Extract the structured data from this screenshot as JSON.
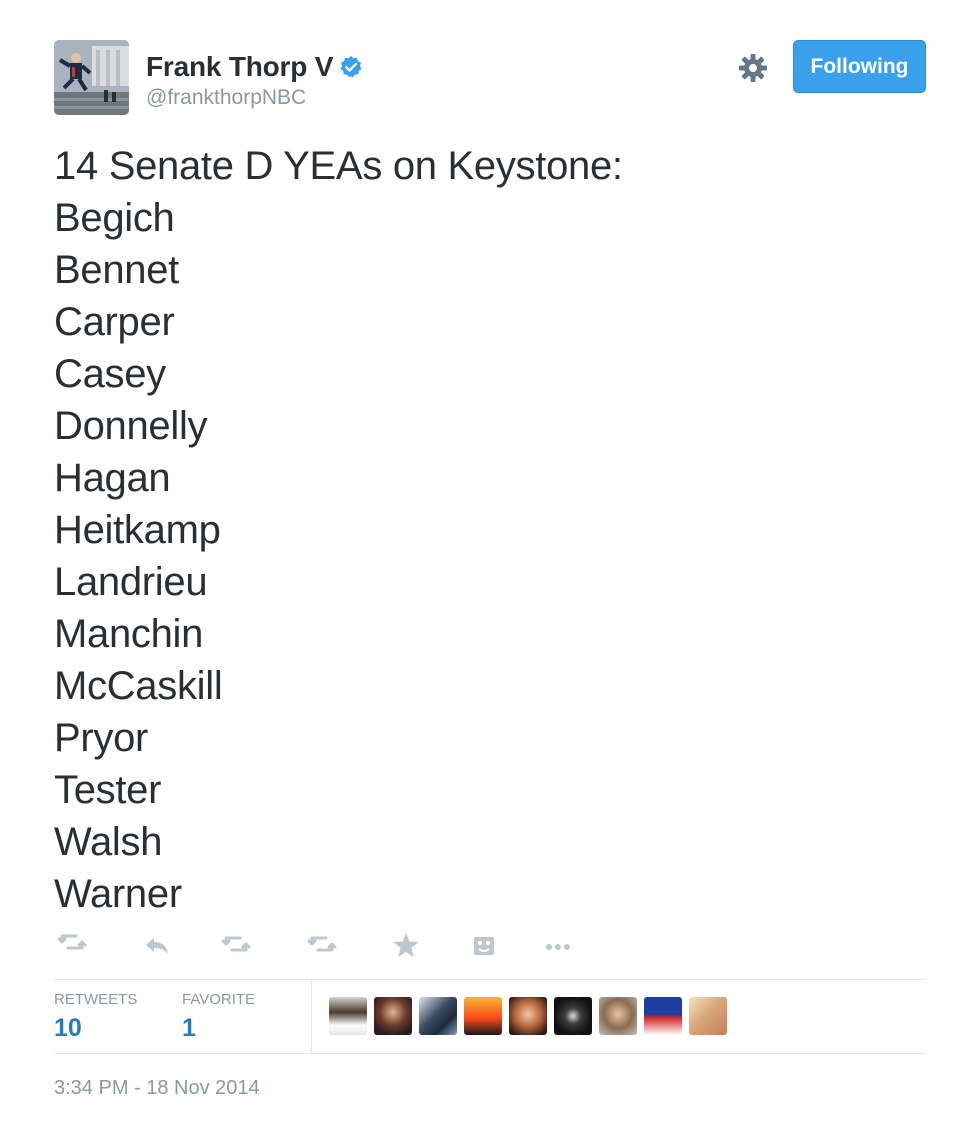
{
  "tweet": {
    "author": {
      "display_name": "Frank Thorp V",
      "handle": "@frankthorpNBC",
      "verified": true
    },
    "follow_button_label": "Following",
    "text_lines": [
      "14 Senate D YEAs on Keystone:",
      "Begich",
      "Bennet",
      "Carper",
      "Casey",
      "Donnelly",
      "Hagan",
      "Heitkamp",
      "Landrieu",
      "Manchin",
      "McCaskill",
      "Pryor",
      "Tester",
      "Walsh",
      "Warner"
    ],
    "actions": [
      "retweet-icon",
      "reply-icon",
      "retweet-icon",
      "retweet-icon",
      "favorite-star-icon",
      "photo-icon",
      "more-icon"
    ],
    "stats": {
      "retweets_label": "RETWEETS",
      "retweets_value": "10",
      "favorites_label": "FAVORITE",
      "favorites_value": "1"
    },
    "favoriter_avatars_count": 9,
    "timestamp": "3:34 PM - 18 Nov 2014"
  },
  "colors": {
    "accent": "#3aa0eb",
    "link": "#2b7bb9",
    "muted": "#8899a6",
    "text": "#292f33",
    "icon": "#bcc7d0"
  }
}
